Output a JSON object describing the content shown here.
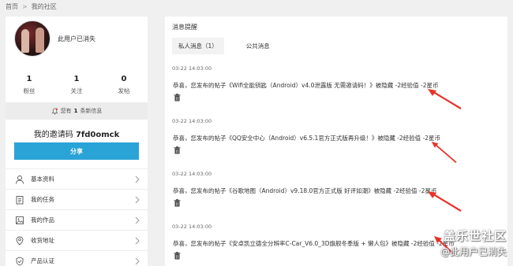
{
  "breadcrumb": {
    "home": "首页",
    "separator": ">",
    "current": "我的社区"
  },
  "profile": {
    "username": "此用户已消失"
  },
  "stats": [
    {
      "num": "1",
      "label": "粉丝"
    },
    {
      "num": "1",
      "label": "关注"
    },
    {
      "num": "0",
      "label": "发帖"
    }
  ],
  "notice": {
    "prefix": "您有",
    "count": "1",
    "suffix": "条新信息",
    "icon": "bell-icon"
  },
  "invite": {
    "label": "我的邀请码",
    "code": "7fd0omck"
  },
  "share_label": "分享",
  "menu": [
    {
      "label": "基本资料",
      "icon": "user-icon"
    },
    {
      "label": "我的任务",
      "icon": "task-icon"
    },
    {
      "label": "我的作品",
      "icon": "works-icon"
    },
    {
      "label": "收货地址",
      "icon": "location-icon"
    },
    {
      "label": "产品认证",
      "icon": "certify-icon"
    }
  ],
  "right": {
    "title": "消息提醒",
    "tabs": [
      {
        "label": "私人消息（1）"
      },
      {
        "label": "公共消息"
      }
    ]
  },
  "messages": [
    {
      "time": "03-22 14:03:00",
      "text": "恭喜，您发布的帖子《Wifi全能钥匙（Android）v4.0泄露版 无需邀请码！》被隐藏 -2经验值 -2星币"
    },
    {
      "time": "03-22 14:03:00",
      "text": "恭喜，您发布的帖子《QQ安全中心（Android）v6.5.1官方正式版再升级！》被隐藏 -2经验值 -2星币"
    },
    {
      "time": "03-22 14:03:00",
      "text": "恭喜，您发布的帖子《谷歌地图（Android）v9.18.0官方正式版 好评如潮》被隐藏 -2经验值 -2星币"
    },
    {
      "time": "03-22 14:03:00",
      "text": "恭喜，您发布的帖子《安卓凯立德全分辨率C-Car_V6.0_3D旗舰冬季版 + 懒人包》被隐藏 -2经验值 -2星币"
    }
  ],
  "watermark": {
    "line1": "盖乐世社区",
    "line2": "@此用户已消失"
  },
  "colors": {
    "accent": "#2aa3d7",
    "arrow": "#e8332a"
  }
}
